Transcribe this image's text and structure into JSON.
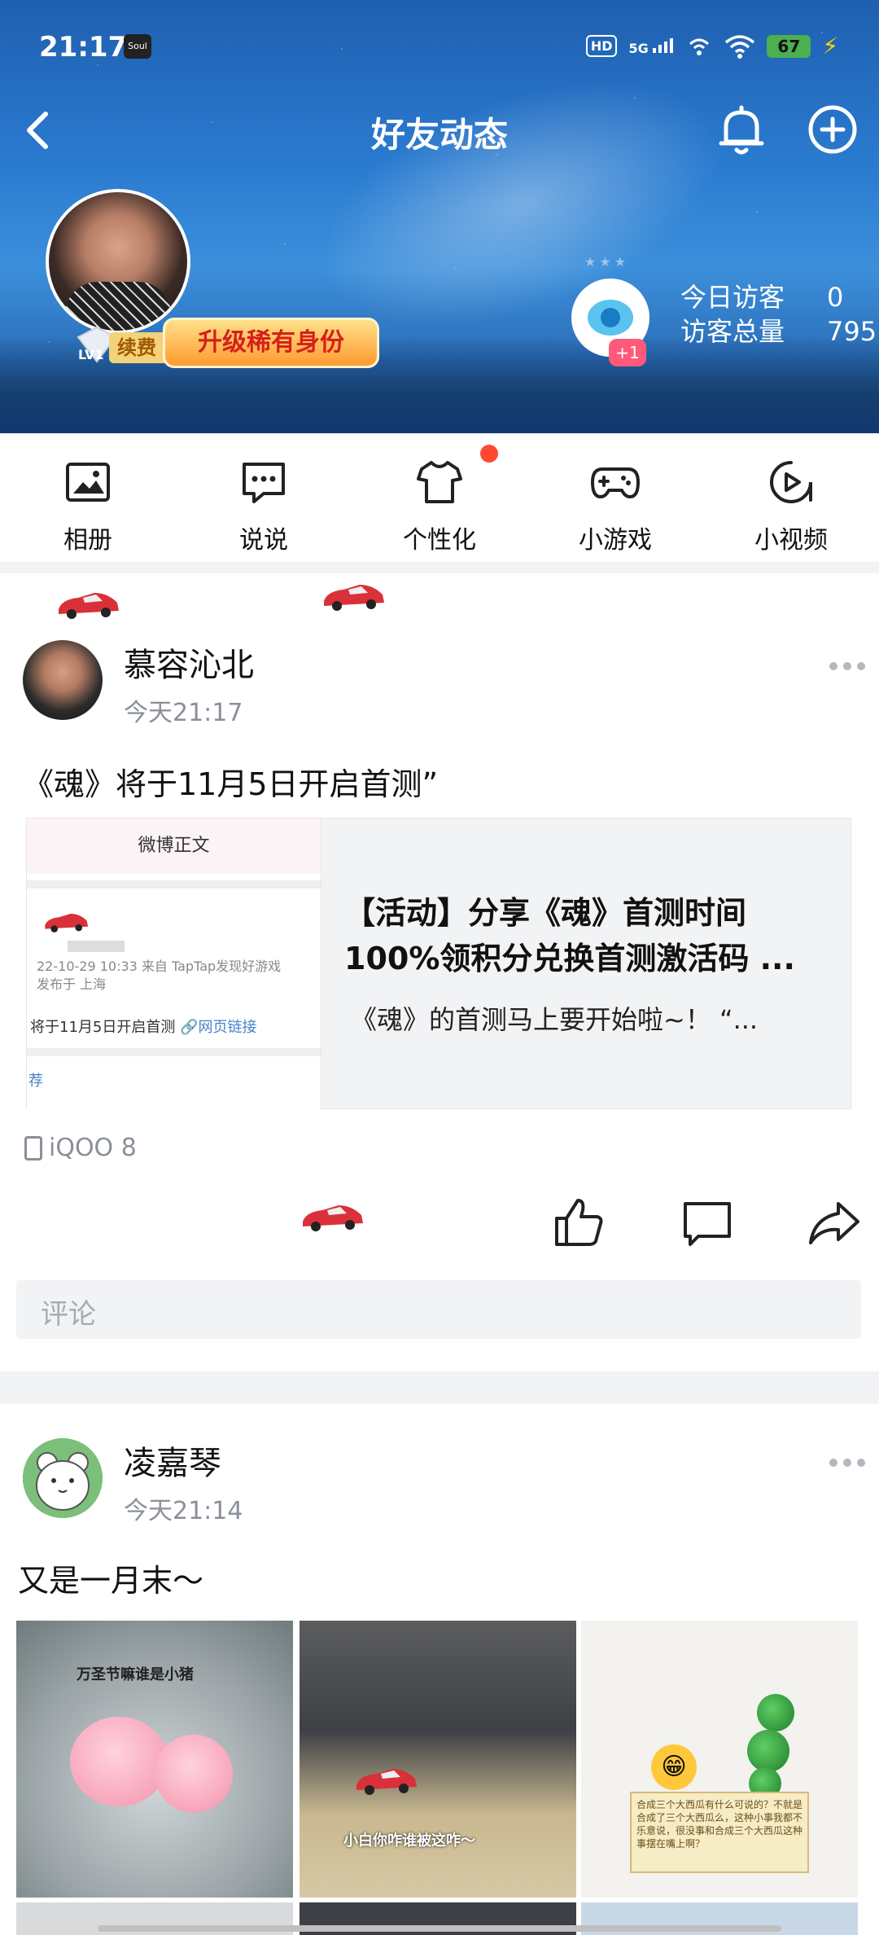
{
  "status_bar": {
    "time": "21:17",
    "app_icon_text": "Soul",
    "hd": "HD",
    "network": "5G",
    "battery": "67"
  },
  "nav": {
    "title": "好友动态"
  },
  "profile": {
    "level": "LV1",
    "renew_label": "续费",
    "upgrade_label": "升级稀有身份"
  },
  "visitors": {
    "badge": "+1",
    "today_label": "今日访客",
    "today_value": "0",
    "total_label": "访客总量",
    "total_value": "795"
  },
  "quick_entries": [
    {
      "label": "相册",
      "icon": "photo-album-icon"
    },
    {
      "label": "说说",
      "icon": "chat-bubble-icon"
    },
    {
      "label": "个性化",
      "icon": "tshirt-icon"
    },
    {
      "label": "小游戏",
      "icon": "gamepad-icon"
    },
    {
      "label": "小视频",
      "icon": "play-video-icon"
    }
  ],
  "posts": [
    {
      "author": "慕容沁北",
      "time": "今天21:17",
      "text": "《魂》将于11月5日开启首测”",
      "link_card": {
        "thumb_header": "微博正文",
        "thumb_meta1": "22-10-29 10:33  来自 TapTap发现好游戏",
        "thumb_meta2": "发布于 上海",
        "thumb_line": "将于11月5日开启首测",
        "thumb_link": "网页链接",
        "thumb_tag": "荐",
        "title": "【活动】分享《魂》首测时间100%领积分兑换首测激活码 ...",
        "desc": "《魂》的首测马上要开始啦~！ “..."
      },
      "device": "iQOO 8",
      "comment_placeholder": "评论"
    },
    {
      "author": "凌嘉琴",
      "time": "今天21:14",
      "text": "又是一月末～",
      "photos": [
        {
          "caption": "万圣节嘛谁是小猪"
        },
        {
          "caption": "小白你咋谁被这咋～"
        },
        {
          "note": "合成三个大西瓜有什么可说的？不就是合成了三个大西瓜么，这种小事我都不乐意说，很没事和合成三个大西瓜这种事摆在嘴上啊？"
        }
      ]
    }
  ]
}
